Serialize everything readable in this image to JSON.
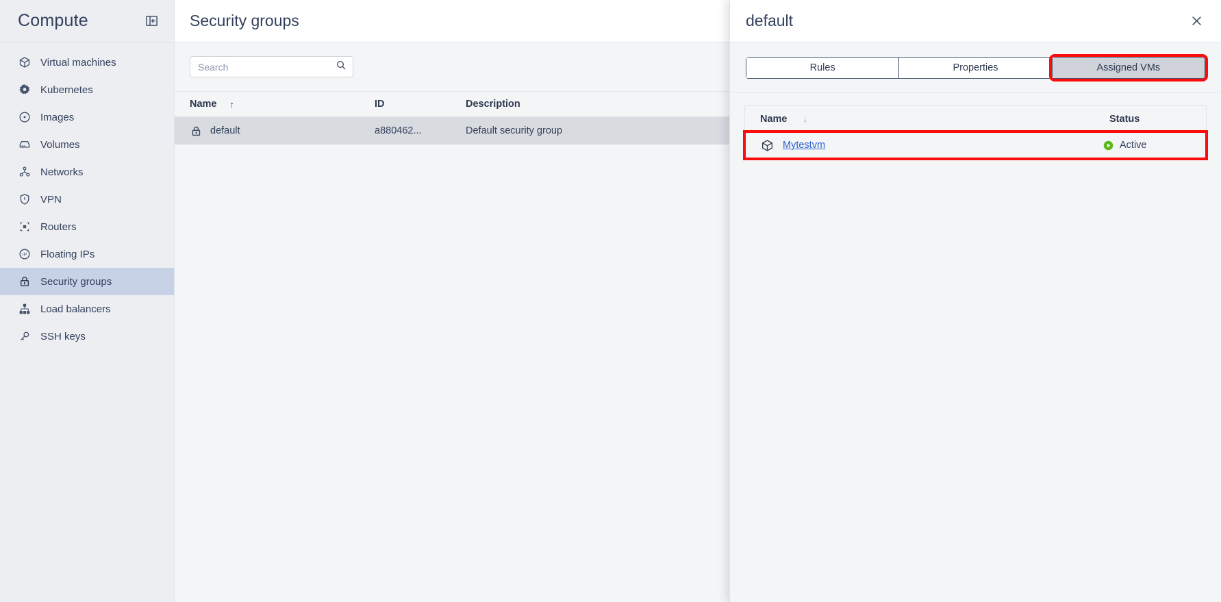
{
  "sidebar": {
    "title": "Compute",
    "collapse_icon": "panel-collapse-icon",
    "items": [
      {
        "label": "Virtual machines",
        "icon": "cube-icon",
        "active": false
      },
      {
        "label": "Kubernetes",
        "icon": "kubernetes-icon",
        "active": false
      },
      {
        "label": "Images",
        "icon": "disc-icon",
        "active": false
      },
      {
        "label": "Volumes",
        "icon": "drive-icon",
        "active": false
      },
      {
        "label": "Networks",
        "icon": "network-icon",
        "active": false
      },
      {
        "label": "VPN",
        "icon": "shield-icon",
        "active": false
      },
      {
        "label": "Routers",
        "icon": "router-icon",
        "active": false
      },
      {
        "label": "Floating IPs",
        "icon": "floating-ip-icon",
        "active": false
      },
      {
        "label": "Security groups",
        "icon": "lock-icon",
        "active": true
      },
      {
        "label": "Load balancers",
        "icon": "load-balancer-icon",
        "active": false
      },
      {
        "label": "SSH keys",
        "icon": "key-icon",
        "active": false
      }
    ]
  },
  "main": {
    "title": "Security groups",
    "search": {
      "value": "",
      "placeholder": "Search",
      "icon": "search-icon"
    },
    "table": {
      "columns": [
        {
          "key": "name",
          "label": "Name",
          "sort": "asc"
        },
        {
          "key": "id",
          "label": "ID",
          "sort": ""
        },
        {
          "key": "description",
          "label": "Description",
          "sort": ""
        }
      ],
      "rows": [
        {
          "icon": "lock-icon",
          "name": "default",
          "id": "a880462...",
          "description": "Default security group",
          "selected": true
        }
      ]
    }
  },
  "panel": {
    "title": "default",
    "close_icon": "close-icon",
    "tabs": [
      {
        "label": "Rules",
        "active": false,
        "highlighted": false
      },
      {
        "label": "Properties",
        "active": false,
        "highlighted": false
      },
      {
        "label": "Assigned VMs",
        "active": true,
        "highlighted": true
      }
    ],
    "vm_table": {
      "columns": [
        {
          "key": "name",
          "label": "Name",
          "sort": "desc"
        },
        {
          "key": "status",
          "label": "Status",
          "sort": ""
        }
      ],
      "rows": [
        {
          "icon": "cube-icon",
          "name": "Mytestvm",
          "status": "Active",
          "status_icon": "play-circle-icon",
          "highlighted": true
        }
      ]
    }
  },
  "colors": {
    "highlight": "#fc0d0d",
    "link": "#2b5fd0",
    "active_status": "#5cb919",
    "sidebar_bg": "#eceef2",
    "sidebar_active": "#c8d2e6",
    "text": "#33415c"
  }
}
